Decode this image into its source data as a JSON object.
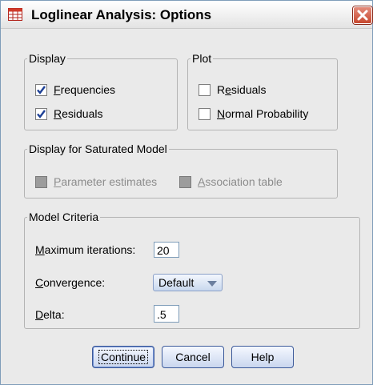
{
  "window": {
    "title": "Loglinear Analysis: Options"
  },
  "display": {
    "legend": "Display",
    "frequencies": {
      "label": "Frequencies",
      "accel": "F",
      "rest": "requencies",
      "checked": true
    },
    "residuals": {
      "label": "Residuals",
      "accel": "R",
      "rest": "esiduals",
      "checked": true
    }
  },
  "plot": {
    "legend": "Plot",
    "residuals": {
      "label": "Residuals",
      "pre": "R",
      "accel": "e",
      "rest": "siduals",
      "checked": false
    },
    "normal_probability": {
      "label": "Normal Probability",
      "accel": "N",
      "rest": "ormal Probability",
      "checked": false
    }
  },
  "saturated": {
    "legend": "Display for Saturated Model",
    "parameter_estimates": {
      "label": "Parameter estimates",
      "accel": "P",
      "rest": "arameter estimates",
      "enabled": false
    },
    "association_table": {
      "label": "Association table",
      "accel": "A",
      "rest": "ssociation table",
      "enabled": false
    }
  },
  "model_criteria": {
    "legend": "Model Criteria",
    "max_iterations": {
      "label": "Maximum iterations:",
      "accel": "M",
      "rest": "aximum iterations:",
      "value": "20"
    },
    "convergence": {
      "label": "Convergence:",
      "accel": "C",
      "rest": "onvergence:",
      "value": "Default"
    },
    "delta": {
      "label": "Delta:",
      "accel": "D",
      "rest": "elta:",
      "value": ".5"
    }
  },
  "buttons": {
    "continue": "Continue",
    "cancel": "Cancel",
    "help": "Help"
  },
  "colors": {
    "dialog_bg": "#eaeaea",
    "close_red": "#c7482f",
    "check_blue": "#1c3f95"
  },
  "icons": {
    "app": "table-icon",
    "close": "close-icon",
    "check": "check-icon",
    "dropdown": "chevron-down-icon"
  }
}
